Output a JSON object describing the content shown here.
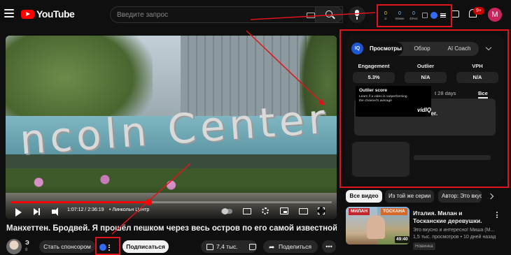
{
  "header": {
    "logo_text": "YouTube",
    "search_placeholder": "Введите запрос",
    "notifications_badge": "9+",
    "avatar_letter": "M"
  },
  "vidiq_toolbar": {
    "stats": [
      {
        "value": "0",
        "label": "1г"
      },
      {
        "value": "0",
        "label": "60мин"
      },
      {
        "value": "0",
        "label": "48час"
      }
    ]
  },
  "player": {
    "time": "1:07:12 / 2:36:19",
    "chapter": "• Линкольн Центр",
    "progress_fraction": 0.43,
    "scene_text": "ncoln Center"
  },
  "video": {
    "title": "Манхеттен. Бродвей. Я прошёл пешком через весь остров по его самой известной улице.",
    "channel_name": "Э",
    "channel_subs": "8"
  },
  "actions": {
    "sponsor": "Стать спонсором",
    "subscribe": "Подписаться",
    "likes": "7,4 тыс.",
    "share": "Поделиться",
    "more": "•••"
  },
  "vidiq_panel": {
    "logo": "IQ",
    "tabs": [
      "Просмотры",
      "Обзор",
      "AI Coach"
    ],
    "active_tab": "Просмотры",
    "metrics": [
      {
        "label": "Engagement",
        "value": "5.3%"
      },
      {
        "label": "Outlier",
        "value": "N/A"
      },
      {
        "label": "VPH",
        "value": "N/A"
      }
    ],
    "tooltip": {
      "title": "Outlier score",
      "body": "Learn if a video is outperforming the channel's average",
      "brand": "vidIQ"
    },
    "period": "t 28 days",
    "period_all": "Bce",
    "error_text": "ideo. Please try again later."
  },
  "chips": [
    "Все видео",
    "Из той же серии",
    "Автор: Это вкус"
  ],
  "recommendation": {
    "tag_left": "МИЛАН",
    "tag_right": "ТОСКАНА",
    "duration": "49:40",
    "title": "Италия. Милан и Тосканские деревушки.",
    "channel": "Это вкусно и интересно! Миша (М...",
    "stats": "1,5 тыс. просмотров • 10 дней назад",
    "badge": "Новинка"
  },
  "colors": {
    "background": "#0f0f0f",
    "brand_red": "#ff0000",
    "annotation_red": "#e0141b",
    "vidiq_blue": "#2f6df6"
  }
}
